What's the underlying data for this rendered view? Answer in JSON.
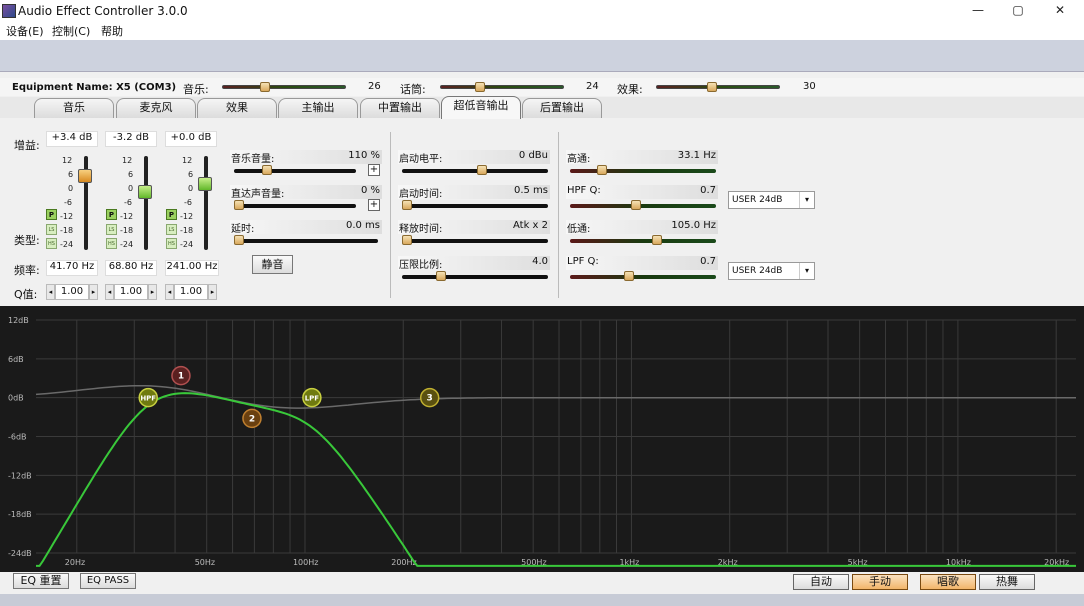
{
  "app": {
    "title": "Audio Effect Controller 3.0.0",
    "window_buttons": {
      "minimize": "—",
      "maximize": "▢",
      "close": "✕"
    }
  },
  "menu": [
    "设备(E)",
    "控制(C)",
    "帮助"
  ],
  "equipment": {
    "name_label": "Equipment Name: X5 (COM3)",
    "music": {
      "label": "音乐:",
      "value": "26",
      "level": 0.33
    },
    "talk": {
      "label": "话筒:",
      "value": "24",
      "level": 0.3
    },
    "effect": {
      "label": "效果:",
      "value": "30",
      "level": 0.45
    }
  },
  "tabs": [
    {
      "label": "音乐",
      "active": false
    },
    {
      "label": "麦克风",
      "active": false
    },
    {
      "label": "效果",
      "active": false
    },
    {
      "label": "主输出",
      "active": false
    },
    {
      "label": "中置输出",
      "active": false
    },
    {
      "label": "超低音输出",
      "active": true
    },
    {
      "label": "后置输出",
      "active": false
    }
  ],
  "eq_bands": {
    "gain_label": "增益:",
    "type_label": "类型:",
    "freq_label": "频率:",
    "q_label": "Q值:",
    "scale": [
      "12",
      "6",
      "0",
      "-6",
      "-12",
      "-18",
      "-24"
    ],
    "type_tags": [
      "P",
      "LS",
      "HS"
    ],
    "bands": [
      {
        "gain": "+3.4 dB",
        "freq": "41.70 Hz",
        "q": "1.00",
        "level": 0.08
      },
      {
        "gain": "-3.2 dB",
        "freq": "68.80 Hz",
        "q": "1.00",
        "level": -0.09
      },
      {
        "gain": "+0.0 dB",
        "freq": "241.00 Hz",
        "q": "1.00",
        "level": 0.0
      }
    ]
  },
  "music_ctrl": {
    "music_vol": {
      "label": "音乐音量:",
      "value": "110 %",
      "level": 0.25
    },
    "direct_vol": {
      "label": "直达声音量:",
      "value": "0 %",
      "level": 0.0
    },
    "delay": {
      "label": "延时:",
      "value": "0.0 ms",
      "level": 0.0
    },
    "mute_label": "静音",
    "plus": "+"
  },
  "compressor": {
    "threshold": {
      "label": "启动电平:",
      "value": "0 dBu",
      "level": 0.55
    },
    "attack": {
      "label": "启动时间:",
      "value": "0.5 ms",
      "level": 0.0
    },
    "release": {
      "label": "释放时间:",
      "value": "Atk x 2",
      "level": 0.0
    },
    "ratio": {
      "label": "压限比例:",
      "value": "4.0",
      "level": 0.25
    }
  },
  "filters": {
    "hpf": {
      "label": "高通:",
      "value": "33.1 Hz",
      "level": 0.2
    },
    "hpf_q": {
      "label": "HPF Q:",
      "value": "0.7",
      "level": 0.45
    },
    "lpf": {
      "label": "低通:",
      "value": "105.0 Hz",
      "level": 0.6
    },
    "lpf_q": {
      "label": "LPF Q:",
      "value": "0.7",
      "level": 0.4
    },
    "hpf_type": "USER 24dB",
    "lpf_type": "USER 24dB"
  },
  "eq_graph": {
    "y_labels": [
      "12dB",
      "6dB",
      "0dB",
      "-6dB",
      "-12dB",
      "-18dB",
      "-24dB"
    ],
    "x_labels": [
      "20Hz",
      "50Hz",
      "100Hz",
      "200Hz",
      "500Hz",
      "1kHz",
      "2kHz",
      "5kHz",
      "10kHz",
      "20kHz"
    ],
    "nodes": {
      "hpf": "HPF",
      "lpf": "LPF",
      "n1": "1",
      "n2": "2",
      "n3": "3"
    },
    "colors": {
      "grid": "#3a3a3a",
      "curve": "#39c83a",
      "flat": "#6a6a6a"
    }
  },
  "bottom": {
    "eq_reset": "EQ 重置",
    "eq_pass": "EQ PASS",
    "modes": [
      {
        "label": "自动",
        "on": false
      },
      {
        "label": "手动",
        "on": true
      },
      {
        "label": "唱歌",
        "on": true
      },
      {
        "label": "热舞",
        "on": false
      }
    ]
  }
}
